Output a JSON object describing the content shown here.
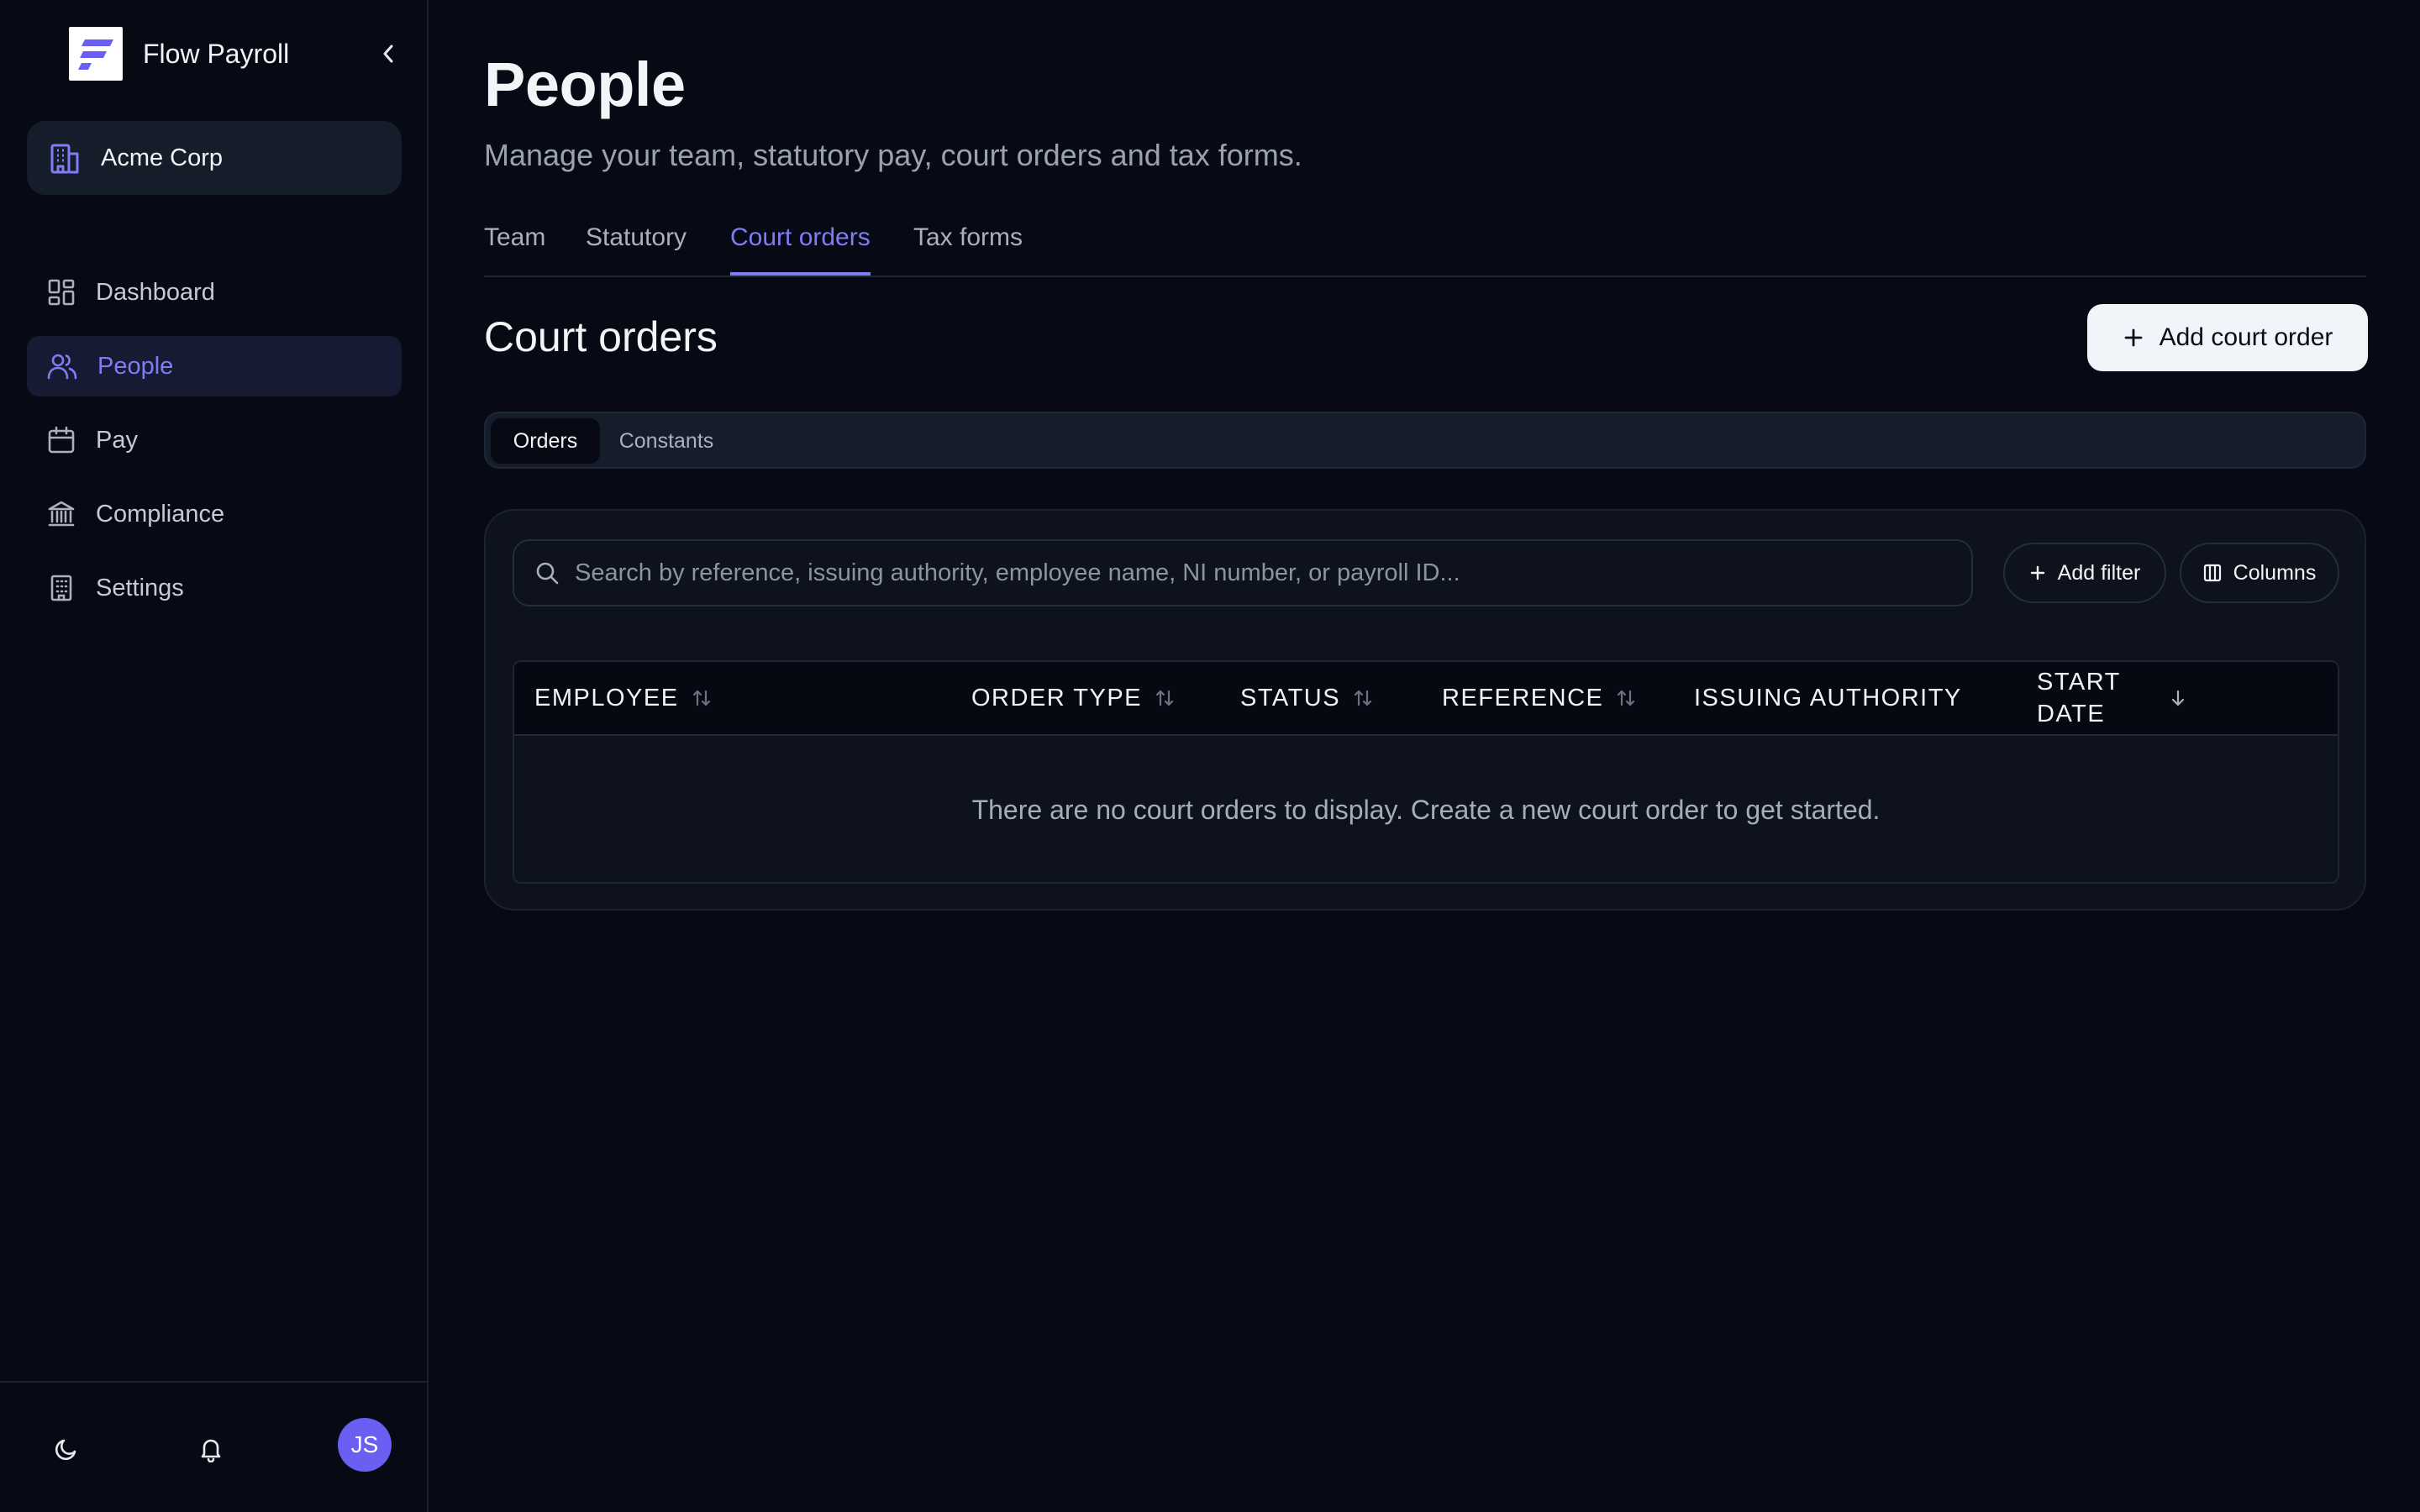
{
  "app": {
    "name": "Flow Payroll"
  },
  "org": {
    "name": "Acme Corp"
  },
  "nav": [
    {
      "label": "Dashboard",
      "icon": "dashboard-icon",
      "active": false
    },
    {
      "label": "People",
      "icon": "users-icon",
      "active": true
    },
    {
      "label": "Pay",
      "icon": "calendar-icon",
      "active": false
    },
    {
      "label": "Compliance",
      "icon": "bank-icon",
      "active": false
    },
    {
      "label": "Settings",
      "icon": "building-icon",
      "active": false
    }
  ],
  "user": {
    "initials": "JS"
  },
  "page": {
    "title": "People",
    "subtitle": "Manage your team, statutory pay, court orders and tax forms."
  },
  "tabs": [
    {
      "label": "Team",
      "active": false
    },
    {
      "label": "Statutory",
      "active": false
    },
    {
      "label": "Court orders",
      "active": true
    },
    {
      "label": "Tax forms",
      "active": false
    }
  ],
  "section": {
    "title": "Court orders",
    "add_button": "Add court order"
  },
  "segments": [
    {
      "label": "Orders",
      "active": true
    },
    {
      "label": "Constants",
      "active": false
    }
  ],
  "toolbar": {
    "search_placeholder": "Search by reference, issuing authority, employee name, NI number, or payroll ID...",
    "add_filter": "Add filter",
    "columns": "Columns"
  },
  "table": {
    "columns": [
      {
        "label": "EMPLOYEE",
        "sort": "both"
      },
      {
        "label": "ORDER TYPE",
        "sort": "both"
      },
      {
        "label": "STATUS",
        "sort": "both"
      },
      {
        "label": "REFERENCE",
        "sort": "both"
      },
      {
        "label": "ISSUING AUTHORITY",
        "sort": "none"
      },
      {
        "label": "START DATE",
        "sort": "down"
      }
    ],
    "empty_message": "There are no court orders to display. Create a new court order to get started."
  },
  "colors": {
    "background": "#070a14",
    "accent": "#7f7cf5",
    "avatar": "#6a5ff2",
    "button_bg": "#f1f4f8"
  }
}
